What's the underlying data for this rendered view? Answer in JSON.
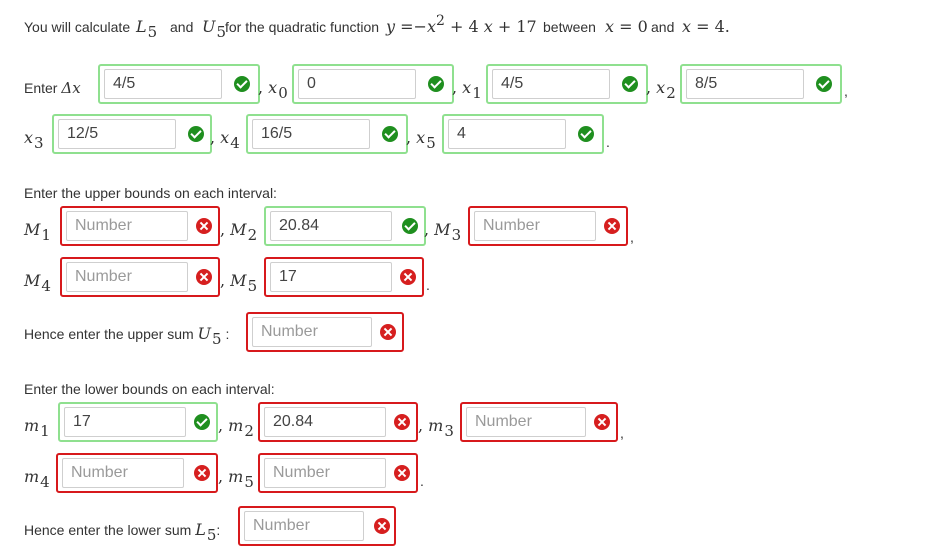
{
  "intro": {
    "prefix": "You will calculate",
    "and": "and",
    "for_text": "for the quadratic function",
    "between": "between",
    "and2": "and"
  },
  "dx_label": "Enter",
  "fields": {
    "dx": "4/5",
    "x0": "0",
    "x1": "4/5",
    "x2": "8/5",
    "x3": "12/5",
    "x4": "16/5",
    "x5": "4",
    "M1": "",
    "M2": "20.84",
    "M3": "",
    "M4": "",
    "M5": "17",
    "U5": "",
    "m1": "17",
    "m2": "20.84",
    "m3": "",
    "m4": "",
    "m5": "",
    "L5": ""
  },
  "placeholder": "Number",
  "upper_heading": "Enter the upper bounds on each interval:",
  "upper_sum_label": "Hence enter the upper sum",
  "lower_heading": "Enter the lower bounds on each interval:",
  "lower_sum_label": "Hence enter the lower sum",
  "colors": {
    "correct": "#1f8f1f",
    "incorrect": "#d61f1f",
    "correct_border": "#8fe08f",
    "incorrect_border": "#d7191c"
  }
}
